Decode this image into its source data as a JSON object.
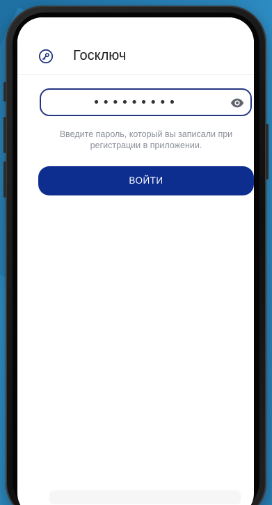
{
  "app": {
    "title": "Госключ"
  },
  "login_form": {
    "password_value": "•••••••••",
    "hint_text": "Введите пароль, который вы записали при регистрации в приложении.",
    "login_label": "ВОЙТИ"
  },
  "icons": {
    "app_logo": "key-in-circle-icon",
    "toggle_password": "eye-icon"
  },
  "colors": {
    "primary": "#0d2d8f",
    "field_border": "#253680",
    "hint_text": "#8a8f97",
    "background": "#2b7fb0"
  }
}
